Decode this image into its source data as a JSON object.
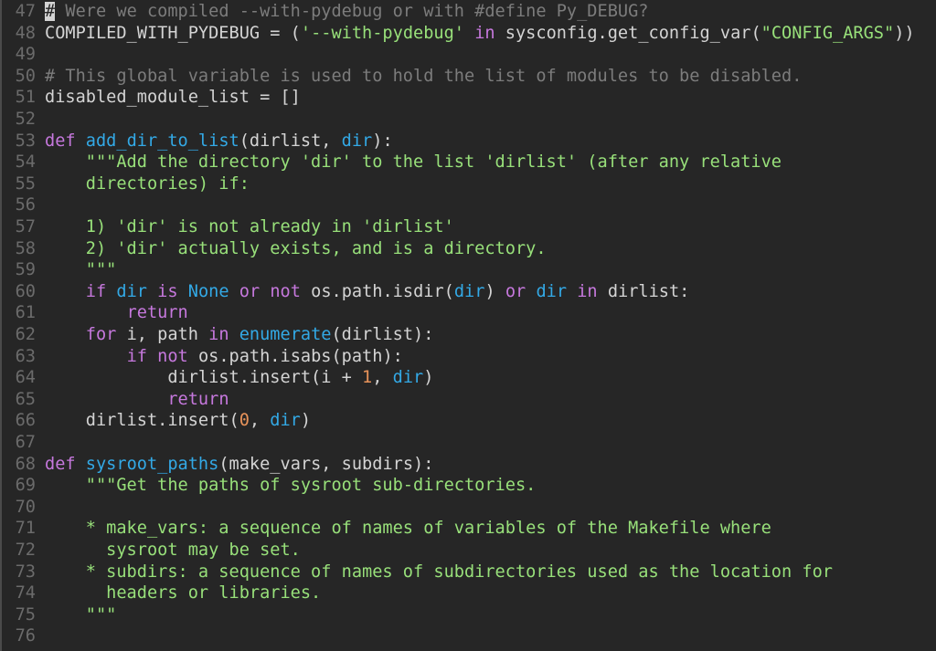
{
  "editor": {
    "lines": [
      {
        "n": "47",
        "tokens": [
          [
            "cursor",
            "#"
          ],
          [
            "comment",
            " Were we compiled --with-pydebug or with #define Py_DEBUG?"
          ]
        ]
      },
      {
        "n": "48",
        "tokens": [
          [
            "plain",
            "COMPILED_WITH_PYDEBUG = ("
          ],
          [
            "string",
            "'--with-pydebug'"
          ],
          [
            "plain",
            " "
          ],
          [
            "keyword",
            "in"
          ],
          [
            "plain",
            " sysconfig.get_config_var("
          ],
          [
            "string",
            "\"CONFIG_ARGS\""
          ],
          [
            "plain",
            "))"
          ]
        ]
      },
      {
        "n": "49",
        "tokens": []
      },
      {
        "n": "50",
        "tokens": [
          [
            "comment",
            "# This global variable is used to hold the list of modules to be disabled."
          ]
        ]
      },
      {
        "n": "51",
        "tokens": [
          [
            "plain",
            "disabled_module_list = []"
          ]
        ]
      },
      {
        "n": "52",
        "tokens": []
      },
      {
        "n": "53",
        "tokens": [
          [
            "keyword",
            "def"
          ],
          [
            "plain",
            " "
          ],
          [
            "builtin",
            "add_dir_to_list"
          ],
          [
            "plain",
            "(dirlist, "
          ],
          [
            "builtin",
            "dir"
          ],
          [
            "plain",
            "):"
          ]
        ]
      },
      {
        "n": "54",
        "tokens": [
          [
            "plain",
            "    "
          ],
          [
            "string",
            "\"\"\"Add the directory 'dir' to the list 'dirlist' (after any relative"
          ]
        ]
      },
      {
        "n": "55",
        "tokens": [
          [
            "string",
            "    directories) if:"
          ]
        ]
      },
      {
        "n": "56",
        "tokens": []
      },
      {
        "n": "57",
        "tokens": [
          [
            "string",
            "    1) 'dir' is not already in 'dirlist'"
          ]
        ]
      },
      {
        "n": "58",
        "tokens": [
          [
            "string",
            "    2) 'dir' actually exists, and is a directory."
          ]
        ]
      },
      {
        "n": "59",
        "tokens": [
          [
            "string",
            "    \"\"\""
          ]
        ]
      },
      {
        "n": "60",
        "tokens": [
          [
            "plain",
            "    "
          ],
          [
            "keyword",
            "if"
          ],
          [
            "plain",
            " "
          ],
          [
            "builtin",
            "dir"
          ],
          [
            "plain",
            " "
          ],
          [
            "keyword",
            "is"
          ],
          [
            "plain",
            " "
          ],
          [
            "builtin",
            "None"
          ],
          [
            "plain",
            " "
          ],
          [
            "keyword",
            "or"
          ],
          [
            "plain",
            " "
          ],
          [
            "keyword",
            "not"
          ],
          [
            "plain",
            " os.path.isdir("
          ],
          [
            "builtin",
            "dir"
          ],
          [
            "plain",
            ") "
          ],
          [
            "keyword",
            "or"
          ],
          [
            "plain",
            " "
          ],
          [
            "builtin",
            "dir"
          ],
          [
            "plain",
            " "
          ],
          [
            "keyword",
            "in"
          ],
          [
            "plain",
            " dirlist:"
          ]
        ]
      },
      {
        "n": "61",
        "tokens": [
          [
            "plain",
            "        "
          ],
          [
            "keyword",
            "return"
          ]
        ]
      },
      {
        "n": "62",
        "tokens": [
          [
            "plain",
            "    "
          ],
          [
            "keyword",
            "for"
          ],
          [
            "plain",
            " i, path "
          ],
          [
            "keyword",
            "in"
          ],
          [
            "plain",
            " "
          ],
          [
            "builtin",
            "enumerate"
          ],
          [
            "plain",
            "(dirlist):"
          ]
        ]
      },
      {
        "n": "63",
        "tokens": [
          [
            "plain",
            "        "
          ],
          [
            "keyword",
            "if"
          ],
          [
            "plain",
            " "
          ],
          [
            "keyword",
            "not"
          ],
          [
            "plain",
            " os.path.isabs(path):"
          ]
        ]
      },
      {
        "n": "64",
        "tokens": [
          [
            "plain",
            "            dirlist.insert(i + "
          ],
          [
            "number",
            "1"
          ],
          [
            "plain",
            ", "
          ],
          [
            "builtin",
            "dir"
          ],
          [
            "plain",
            ")"
          ]
        ]
      },
      {
        "n": "65",
        "tokens": [
          [
            "plain",
            "            "
          ],
          [
            "keyword",
            "return"
          ]
        ]
      },
      {
        "n": "66",
        "tokens": [
          [
            "plain",
            "    dirlist.insert("
          ],
          [
            "number",
            "0"
          ],
          [
            "plain",
            ", "
          ],
          [
            "builtin",
            "dir"
          ],
          [
            "plain",
            ")"
          ]
        ]
      },
      {
        "n": "67",
        "tokens": []
      },
      {
        "n": "68",
        "tokens": [
          [
            "keyword",
            "def"
          ],
          [
            "plain",
            " "
          ],
          [
            "builtin",
            "sysroot_paths"
          ],
          [
            "plain",
            "(make_vars, subdirs):"
          ]
        ]
      },
      {
        "n": "69",
        "tokens": [
          [
            "plain",
            "    "
          ],
          [
            "string",
            "\"\"\"Get the paths of sysroot sub-directories."
          ]
        ]
      },
      {
        "n": "70",
        "tokens": []
      },
      {
        "n": "71",
        "tokens": [
          [
            "string",
            "    * make_vars: a sequence of names of variables of the Makefile where"
          ]
        ]
      },
      {
        "n": "72",
        "tokens": [
          [
            "string",
            "      sysroot may be set."
          ]
        ]
      },
      {
        "n": "73",
        "tokens": [
          [
            "string",
            "    * subdirs: a sequence of names of subdirectories used as the location for"
          ]
        ]
      },
      {
        "n": "74",
        "tokens": [
          [
            "string",
            "      headers or libraries."
          ]
        ]
      },
      {
        "n": "75",
        "tokens": [
          [
            "string",
            "    \"\"\""
          ]
        ]
      },
      {
        "n": "76",
        "tokens": []
      }
    ]
  },
  "colors": {
    "background": "#262626",
    "line_number": "#6b6b6b",
    "comment": "#7c7c7c",
    "keyword": "#c678dd",
    "builtin": "#33a9e6",
    "string": "#98e07a",
    "number": "#e8935a",
    "plain": "#d4d4d4"
  }
}
